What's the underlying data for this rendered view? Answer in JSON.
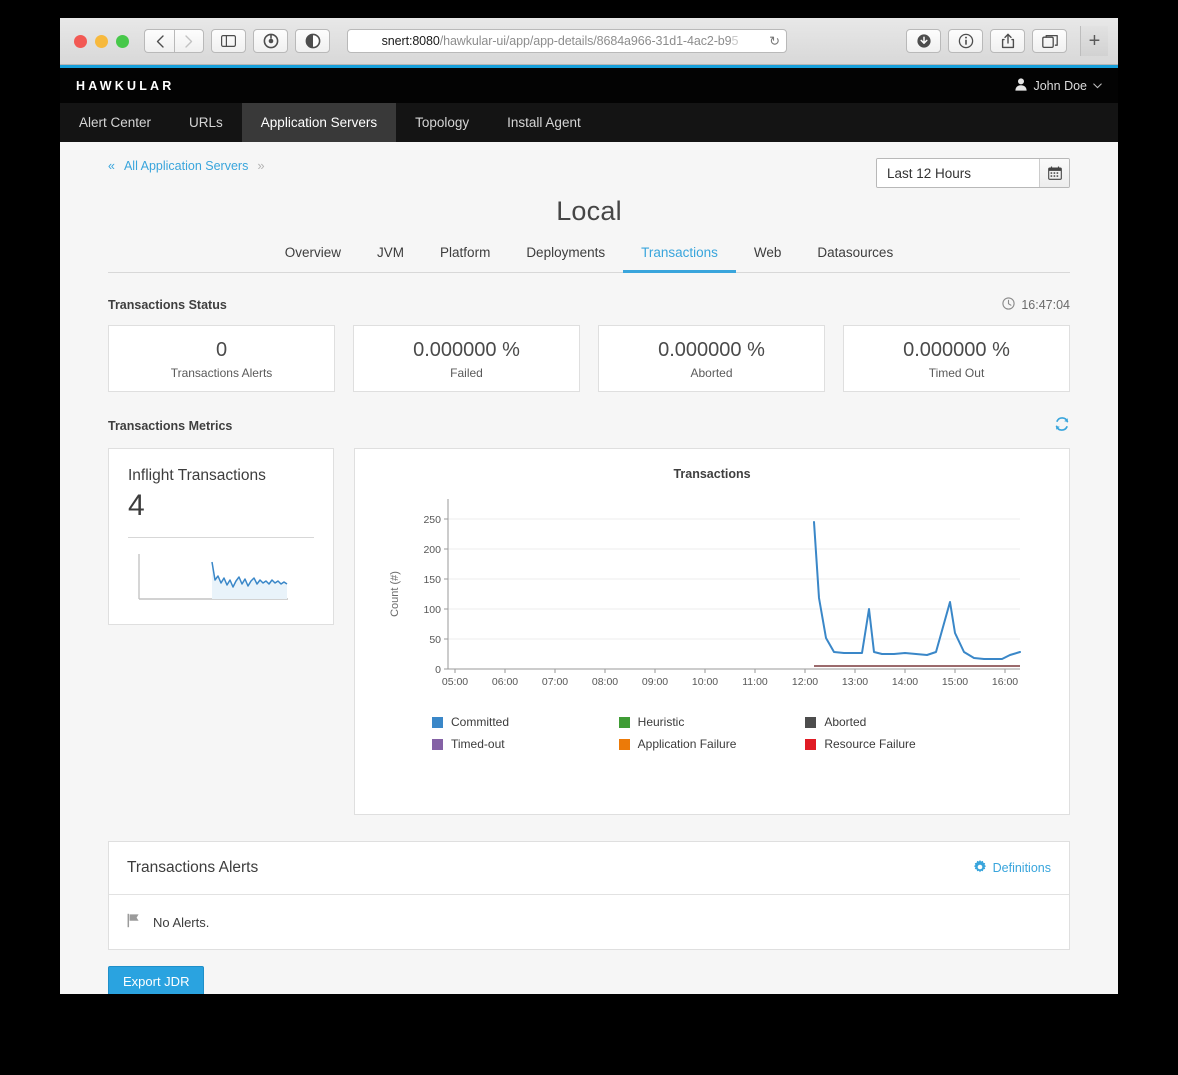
{
  "browser": {
    "url_host": "snert:8080",
    "url_path": "/hawkular-ui/app/app-details/8684a966-31d1-4ac2-b9",
    "url_fade": "5",
    "back_icon": "‹",
    "forward_icon": "›",
    "sidebar_icon": "sidebar-icon",
    "reload_icon": "↻",
    "new_tab_label": "+"
  },
  "header": {
    "logo": "HAWKULAR",
    "user_name": "John Doe",
    "user_caret": "⌄"
  },
  "nav": {
    "items": [
      {
        "label": "Alert Center",
        "active": false
      },
      {
        "label": "URLs",
        "active": false
      },
      {
        "label": "Application Servers",
        "active": true
      },
      {
        "label": "Topology",
        "active": false
      },
      {
        "label": "Install Agent",
        "active": false
      }
    ]
  },
  "breadcrumb": {
    "prefix": "«",
    "label": "All Application Servers",
    "suffix": "»"
  },
  "timerange": {
    "value": "Last 12 Hours",
    "placeholder": "Last 12 Hours"
  },
  "page": {
    "title": "Local",
    "tabs": [
      {
        "label": "Overview",
        "active": false
      },
      {
        "label": "JVM",
        "active": false
      },
      {
        "label": "Platform",
        "active": false
      },
      {
        "label": "Deployments",
        "active": false
      },
      {
        "label": "Transactions",
        "active": true
      },
      {
        "label": "Web",
        "active": false
      },
      {
        "label": "Datasources",
        "active": false
      }
    ]
  },
  "status_section": {
    "title": "Transactions Status",
    "timestamp": "16:47:04",
    "cards": [
      {
        "value": "0",
        "label": "Transactions Alerts"
      },
      {
        "value": "0.000000 %",
        "label": "Failed"
      },
      {
        "value": "0.000000 %",
        "label": "Aborted"
      },
      {
        "value": "0.000000 %",
        "label": "Timed Out"
      }
    ]
  },
  "metrics_section": {
    "title": "Transactions Metrics",
    "inflight": {
      "title": "Inflight Transactions",
      "value": "4"
    }
  },
  "alerts_panel": {
    "title": "Transactions Alerts",
    "definitions_label": "Definitions",
    "empty_text": "No Alerts."
  },
  "footer": {
    "export_label": "Export JDR"
  },
  "colors": {
    "accent": "#39a5dc",
    "committed": "#3a87c8",
    "heuristic": "#3f9c35",
    "aborted": "#4d4d4d",
    "timed_out": "#8461a5",
    "application_failure": "#ec7a08",
    "resource_failure": "#e01b24",
    "button_blue": "#2aa3e0",
    "header_black": "#030303"
  },
  "chart_data": {
    "type": "line",
    "title": "Transactions",
    "xlabel": "",
    "ylabel": "Count (#)",
    "ylim": [
      0,
      280
    ],
    "yticks": [
      0,
      50,
      100,
      150,
      200,
      250
    ],
    "xticks": [
      "05:00",
      "06:00",
      "07:00",
      "08:00",
      "09:00",
      "10:00",
      "11:00",
      "12:00",
      "13:00",
      "14:00",
      "15:00",
      "16:00"
    ],
    "grid": true,
    "legend_position": "bottom",
    "legend": [
      {
        "name": "Committed",
        "color": "#3a87c8"
      },
      {
        "name": "Heuristic",
        "color": "#3f9c35"
      },
      {
        "name": "Aborted",
        "color": "#4d4d4d"
      },
      {
        "name": "Timed-out",
        "color": "#8461a5"
      },
      {
        "name": "Application Failure",
        "color": "#ec7a08"
      },
      {
        "name": "Resource Failure",
        "color": "#e01b24"
      }
    ],
    "series": [
      {
        "name": "Committed",
        "color": "#3a87c8",
        "x": [
          "12:10",
          "12:15",
          "12:25",
          "12:40",
          "12:55",
          "13:10",
          "13:20",
          "13:25",
          "13:32",
          "13:45",
          "14:00",
          "14:15",
          "14:30",
          "14:40",
          "14:50",
          "15:00",
          "15:05",
          "15:15",
          "15:30",
          "15:45",
          "16:00",
          "16:15",
          "16:30",
          "16:40"
        ],
        "values": [
          245,
          118,
          50,
          28,
          28,
          28,
          28,
          100,
          30,
          26,
          26,
          28,
          26,
          25,
          30,
          112,
          60,
          28,
          19,
          18,
          18,
          18,
          24,
          28
        ]
      },
      {
        "name": "Resource Failure",
        "color": "#9b6a6c",
        "x": [
          "12:10",
          "16:40"
        ],
        "values": [
          2,
          2
        ]
      }
    ]
  },
  "sparkline": {
    "series_name": "Inflight Transactions",
    "values": [
      56,
      22,
      28,
      18,
      26,
      16,
      24,
      14,
      22,
      20,
      28,
      18,
      26,
      16,
      22,
      24,
      18,
      22
    ]
  }
}
